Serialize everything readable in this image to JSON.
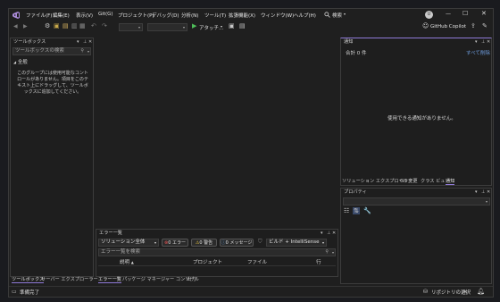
{
  "menu": {
    "items": [
      "ファイル(F)",
      "編集(E)",
      "表示(V)",
      "Git(G)",
      "プロジェクト(P)",
      "デバッグ(D)",
      "分析(N)",
      "ツール(T)",
      "拡張機能(X)",
      "ウィンドウ(W)",
      "ヘルプ(H)"
    ],
    "search": "検索",
    "avatar": "U",
    "copilot": "GitHub Copilot"
  },
  "toolbar": {
    "attach": "アタッチ..."
  },
  "toolbox": {
    "title": "ツールボックス",
    "search_placeholder": "ツールボックスの検索",
    "group": "全般",
    "empty_text": "このグループには使用可能なコントロールがありません。項目をこのテキスト上にドラッグして、ツールボックスに追加してください。",
    "tabs": [
      "ツールボックス",
      "サーバー エクスプローラー"
    ]
  },
  "notifications": {
    "title": "通知",
    "count": "合計 0 件",
    "clear": "すべて削除",
    "empty": "使用できる通知がありません。",
    "tabs": [
      "ソリューション エクスプローラー",
      "Git 変更",
      "クラス ビュー",
      "通知"
    ]
  },
  "properties": {
    "title": "プロパティ"
  },
  "errorlist": {
    "title": "エラー一覧",
    "scope": "ソリューション全体",
    "errors": "0 エラー",
    "warnings": "0 警告",
    "messages": "0 メッセージ",
    "build": "ビルド + IntelliSense",
    "search_placeholder": "エラー一覧を検索",
    "columns": [
      "説明",
      "プロジェクト",
      "ファイル",
      "行"
    ],
    "tabs": [
      "エラー一覧",
      "パッケージ マネージャー コンソール",
      "出力"
    ]
  },
  "status": {
    "ready": "準備完了",
    "repo": "リポジトリの選択"
  }
}
